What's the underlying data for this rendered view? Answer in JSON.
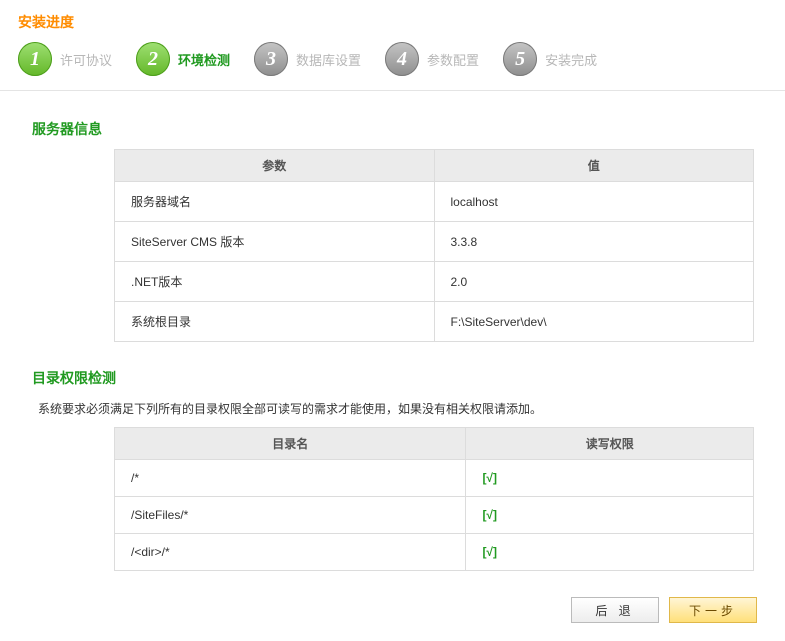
{
  "header": {
    "title": "安装进度"
  },
  "steps": [
    {
      "num": "1",
      "label": "许可协议",
      "state": "done"
    },
    {
      "num": "2",
      "label": "环境检测",
      "state": "active"
    },
    {
      "num": "3",
      "label": "数据库设置",
      "state": "pending"
    },
    {
      "num": "4",
      "label": "参数配置",
      "state": "pending"
    },
    {
      "num": "5",
      "label": "安装完成",
      "state": "pending"
    }
  ],
  "server_info": {
    "title": "服务器信息",
    "headers": {
      "param": "参数",
      "value": "值"
    },
    "rows": [
      {
        "param": "服务器域名",
        "value": "localhost"
      },
      {
        "param": "SiteServer CMS 版本",
        "value": "3.3.8"
      },
      {
        "param": ".NET版本",
        "value": "2.0"
      },
      {
        "param": "系统根目录",
        "value": "F:\\SiteServer\\dev\\"
      }
    ]
  },
  "perm_check": {
    "title": "目录权限检测",
    "desc": "系统要求必须满足下列所有的目录权限全部可读写的需求才能使用，如果没有相关权限请添加。",
    "headers": {
      "dir": "目录名",
      "perm": "读写权限"
    },
    "rows": [
      {
        "dir": "/*",
        "perm": "[√]"
      },
      {
        "dir": "/SiteFiles/*",
        "perm": "[√]"
      },
      {
        "dir": "/<dir>/*",
        "perm": "[√]"
      }
    ]
  },
  "buttons": {
    "back": "后 退",
    "next": "下一步"
  }
}
